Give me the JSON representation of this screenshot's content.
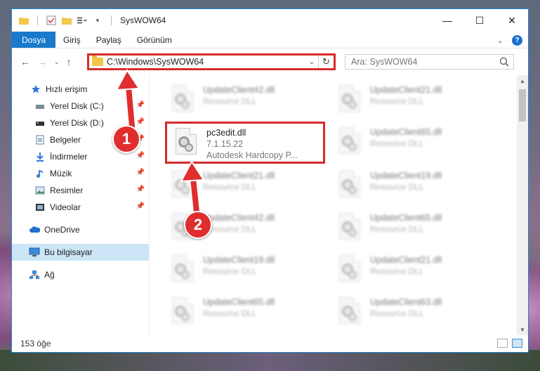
{
  "window": {
    "title": "SysWOW64"
  },
  "controls": {
    "minimize": "—",
    "maximize": "☐",
    "close": "✕"
  },
  "ribbon": {
    "tabs": [
      {
        "label": "Dosya",
        "active": true
      },
      {
        "label": "Giriş",
        "active": false
      },
      {
        "label": "Paylaş",
        "active": false
      },
      {
        "label": "Görünüm",
        "active": false
      }
    ],
    "help_label": "?"
  },
  "address": {
    "path": "C:\\Windows\\SysWOW64"
  },
  "search": {
    "placeholder": "Ara: SysWOW64"
  },
  "sidebar": {
    "items": [
      {
        "label": "Hızlı erişim",
        "icon": "star-icon",
        "pinned": false
      },
      {
        "label": "Yerel Disk (C:)",
        "icon": "drive-icon",
        "pinned": true
      },
      {
        "label": "Yerel Disk (D:)",
        "icon": "drive-icon",
        "pinned": true
      },
      {
        "label": "Belgeler",
        "icon": "documents-icon",
        "pinned": true
      },
      {
        "label": "İndirmeler",
        "icon": "download-icon",
        "pinned": true
      },
      {
        "label": "Müzik",
        "icon": "music-icon",
        "pinned": true
      },
      {
        "label": "Resimler",
        "icon": "pictures-icon",
        "pinned": true
      },
      {
        "label": "Videolar",
        "icon": "videos-icon",
        "pinned": true
      },
      {
        "label": "OneDrive",
        "icon": "cloud-icon",
        "pinned": false
      },
      {
        "label": "Bu bilgisayar",
        "icon": "computer-icon",
        "pinned": false,
        "selected": true
      },
      {
        "label": "Ağ",
        "icon": "network-icon",
        "pinned": false
      }
    ]
  },
  "files": {
    "focused": {
      "name": "pc3edit.dll",
      "version": "7.1.15.22",
      "description": "Autodesk Hardcopy P..."
    },
    "left_column": [
      {
        "name": "UpdateClient42.dll",
        "description": "Resource DLL"
      },
      {
        "name": "UpdateClient21.dll",
        "description": "Resource DLL"
      },
      {
        "name": "UpdateClient42.dll",
        "description": "Resource DLL"
      },
      {
        "name": "UpdateClient19.dll",
        "description": "Resource DLL"
      },
      {
        "name": "UpdateClient65.dll",
        "description": "Resource DLL"
      }
    ],
    "right_column": [
      {
        "name": "UpdateClient21.dll",
        "description": "Resource DLL"
      },
      {
        "name": "UpdateClient65.dll",
        "description": "Resource DLL"
      },
      {
        "name": "UpdateClient19.dll",
        "description": "Resource DLL"
      },
      {
        "name": "UpdateClient65.dll",
        "description": "Resource DLL"
      },
      {
        "name": "UpdateClient21.dll",
        "description": "Resource DLL"
      },
      {
        "name": "UpdateClient63.dll",
        "description": "Resource DLL"
      }
    ]
  },
  "status": {
    "count": "153 öğe"
  },
  "annotations": {
    "step1": "1",
    "step2": "2",
    "color": "#e02d2d"
  }
}
